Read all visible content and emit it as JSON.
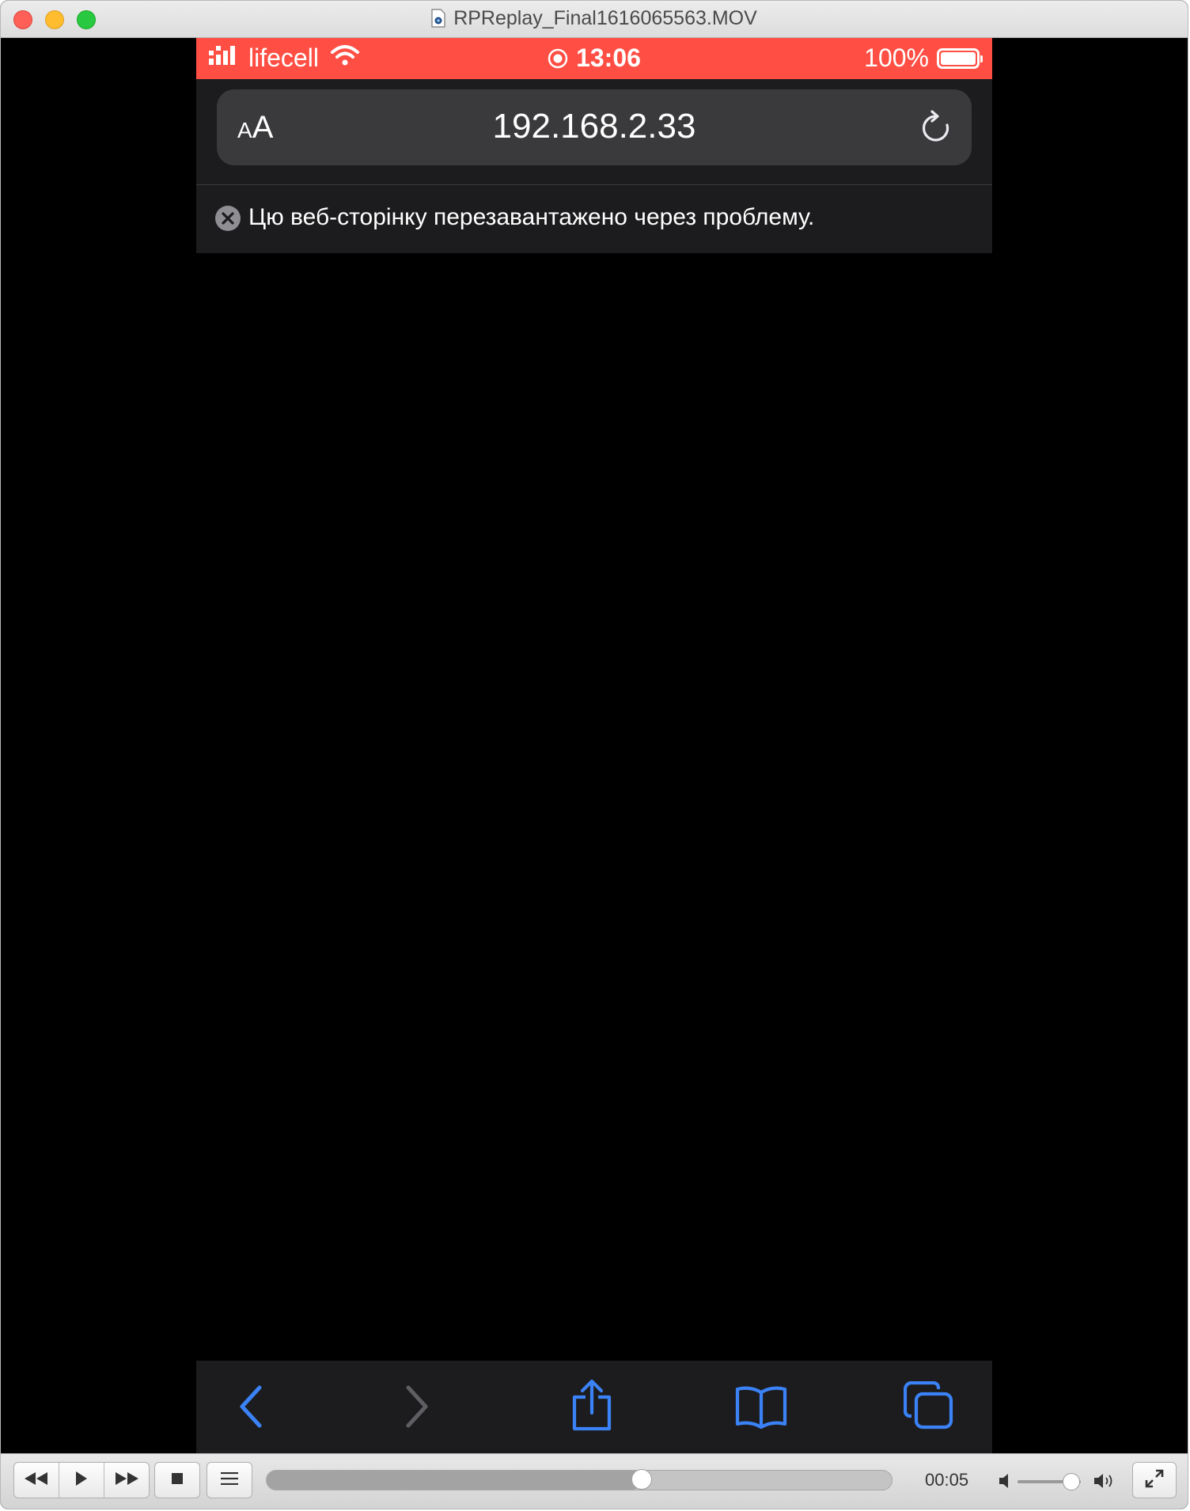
{
  "window": {
    "title": "RPReplay_Final1616065563.MOV"
  },
  "status_bar": {
    "carrier": "lifecell",
    "time": "13:06",
    "battery": "100%",
    "background_color": "#ff4f44"
  },
  "address_bar": {
    "reader_label_small": "A",
    "reader_label_large": "A",
    "url": "192.168.2.33"
  },
  "error_banner": {
    "message": "Цю веб-сторінку перезавантажено через проблему."
  },
  "toolbar": {
    "icons": [
      "back-icon",
      "forward-icon",
      "share-icon",
      "bookmarks-icon",
      "tabs-icon"
    ],
    "accent_color": "#3b82f6"
  },
  "player": {
    "timecode": "00:05",
    "progress": 0.6,
    "volume": 0.85
  }
}
